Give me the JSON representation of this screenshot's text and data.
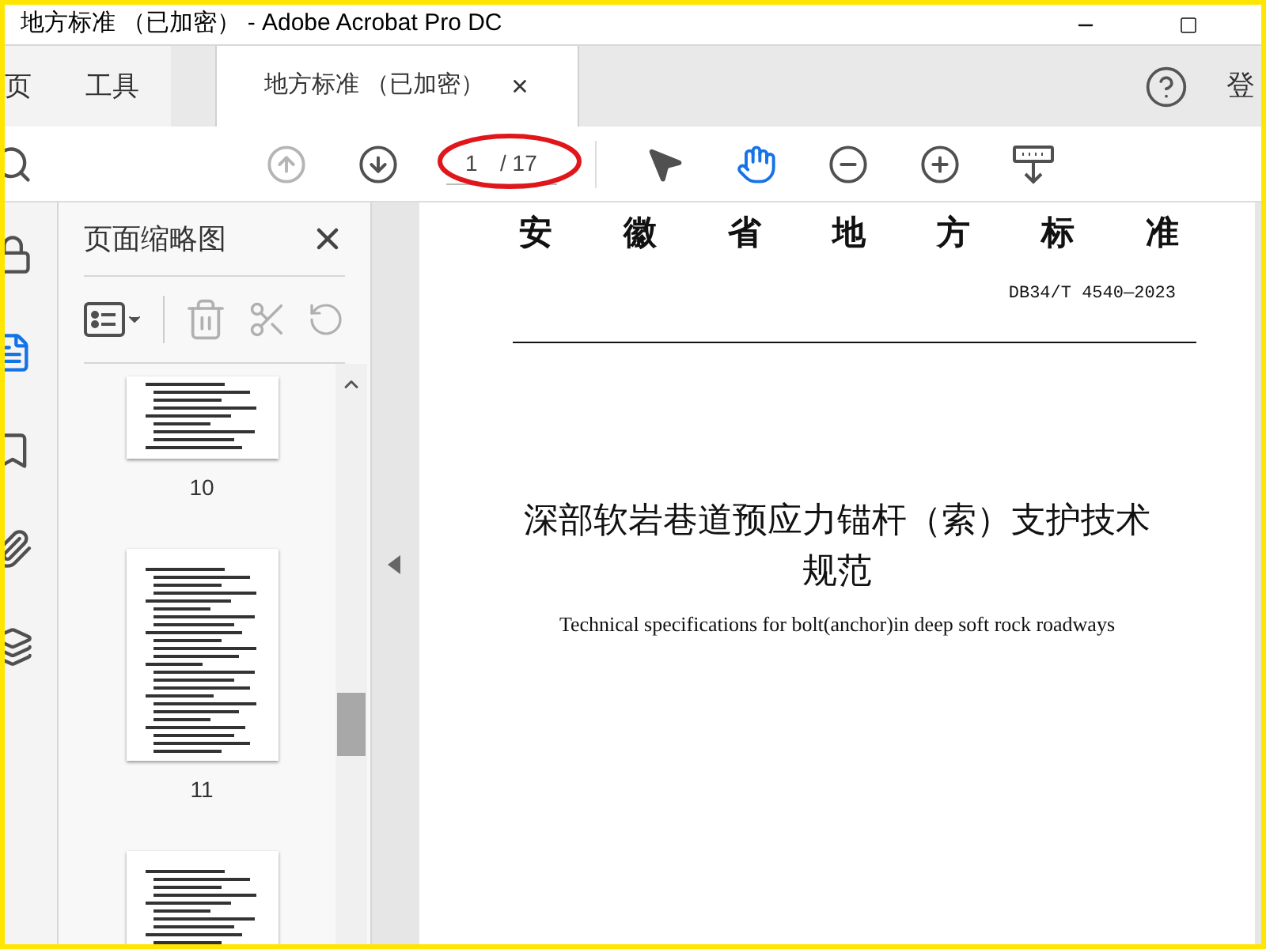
{
  "window": {
    "title": "地方标准 （已加密） - Adobe Acrobat Pro DC"
  },
  "tabs": [
    {
      "label": "页",
      "selected": false,
      "closable": false
    },
    {
      "label": "工具",
      "selected": false,
      "closable": false
    },
    {
      "label": "地方标准 （已加密）",
      "selected": true,
      "closable": true
    }
  ],
  "account_label": "登",
  "toolbar": {
    "page_current": "1",
    "page_total": "/ 17",
    "page_circled": true,
    "tools": [
      {
        "kind": "prev_page",
        "disabled": true,
        "selected": false
      },
      {
        "kind": "next_page",
        "disabled": false,
        "selected": false
      },
      {
        "kind": "page_field"
      },
      {
        "kind": "select",
        "disabled": false,
        "selected": false
      },
      {
        "kind": "hand",
        "disabled": false,
        "selected": true
      },
      {
        "kind": "zoom_out",
        "disabled": false,
        "selected": false
      },
      {
        "kind": "zoom_in",
        "disabled": false,
        "selected": false
      },
      {
        "kind": "scroll_mode",
        "disabled": false,
        "selected": false
      }
    ]
  },
  "side_rail": [
    {
      "kind": "lock",
      "selected": false
    },
    {
      "kind": "pages",
      "selected": true
    },
    {
      "kind": "bookmark",
      "selected": false
    },
    {
      "kind": "attachment",
      "selected": false
    },
    {
      "kind": "layers",
      "selected": false
    }
  ],
  "thumbnail_panel": {
    "title": "页面缩略图",
    "pages": [
      {
        "kind": "top_cut",
        "label": "10"
      },
      {
        "kind": "full",
        "label": "11"
      },
      {
        "kind": "bottom_cut"
      }
    ]
  },
  "document": {
    "heading": "安徽省地方标准",
    "code": "DB34/T 4540—2023",
    "title": "深部软岩巷道预应力锚杆（索）支护技术规范",
    "subtitle": "Technical specifications for bolt(anchor)in deep soft rock roadways"
  }
}
